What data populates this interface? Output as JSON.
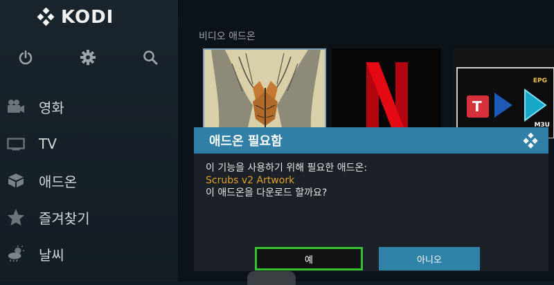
{
  "app": {
    "name": "KODI"
  },
  "sidebar": {
    "top_icons": [
      {
        "icon": "power-icon"
      },
      {
        "icon": "gear-icon"
      },
      {
        "icon": "search-icon"
      }
    ],
    "items": [
      {
        "label": "영화",
        "icon": "movie-camera-icon"
      },
      {
        "label": "TV",
        "icon": "tv-icon"
      },
      {
        "label": "애드온",
        "icon": "addon-box-icon"
      },
      {
        "label": "즐겨찾기",
        "icon": "star-icon"
      },
      {
        "label": "날씨",
        "icon": "weather-icon"
      }
    ]
  },
  "main": {
    "section_title": "비디오 애드온",
    "tiles": [
      {
        "name": "artwork-tile"
      },
      {
        "name": "netflix-tile",
        "mark": "N"
      },
      {
        "name": "epg-tile",
        "epg_label": "EPG",
        "m3u_label": "M3U",
        "t_label": "T"
      }
    ]
  },
  "dialog": {
    "title": "애드온 필요함",
    "line1": "이 기능을 사용하기 위해 필요한 애드온:",
    "addon_name": "Scrubs v2 Artwork",
    "line3": "이 애드온을 다운로드 할까요?",
    "yes_label": "예",
    "no_label": "아니오"
  },
  "colors": {
    "accent": "#2f7fa6",
    "highlight": "#e2a227",
    "focus": "#36c22e"
  }
}
